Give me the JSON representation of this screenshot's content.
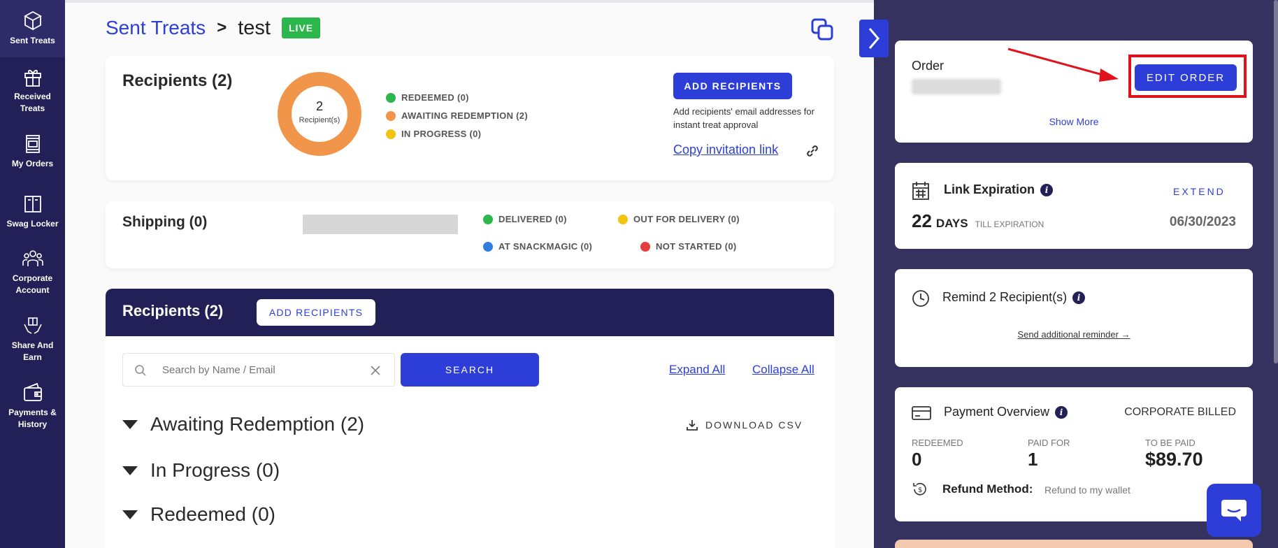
{
  "sidebar": {
    "items": [
      {
        "label": "Sent Treats"
      },
      {
        "label": "Received Treats"
      },
      {
        "label": "My Orders"
      },
      {
        "label": "Swag Locker"
      },
      {
        "label": "Corporate Account"
      },
      {
        "label": "Share And Earn"
      },
      {
        "label": "Payments & History"
      }
    ]
  },
  "breadcrumb": {
    "parent": "Sent Treats",
    "separator": ">",
    "current": "test",
    "badge": "LIVE"
  },
  "recipients_summary": {
    "title": "Recipients (2)",
    "donut_count": "2",
    "donut_label": "Recipient(s)",
    "legend": [
      {
        "label": "REDEEMED (0)",
        "color": "#2bb74b"
      },
      {
        "label": "AWAITING REDEMPTION (2)",
        "color": "#f0954a"
      },
      {
        "label": "IN PROGRESS (0)",
        "color": "#f2c40f"
      }
    ],
    "add_button": "ADD RECIPIENTS",
    "help_text": "Add recipients' email addresses for instant treat approval",
    "copy_link": "Copy invitation link"
  },
  "shipping": {
    "title": "Shipping (0)",
    "legend": [
      {
        "label": "DELIVERED (0)",
        "color": "#2bb74b"
      },
      {
        "label": "OUT FOR DELIVERY (0)",
        "color": "#f2c40f"
      },
      {
        "label": "AT SNACKMAGIC (0)",
        "color": "#2f7ee0"
      },
      {
        "label": "NOT STARTED (0)",
        "color": "#e53e3e"
      }
    ]
  },
  "recipients_table": {
    "title": "Recipients (2)",
    "add_button": "ADD RECIPIENTS",
    "search_placeholder": "Search by Name / Email",
    "search_button": "SEARCH",
    "expand_all": "Expand All",
    "collapse_all": "Collapse All",
    "download_csv": "DOWNLOAD CSV",
    "groups": [
      {
        "label": "Awaiting Redemption (2)"
      },
      {
        "label": "In Progress (0)"
      },
      {
        "label": "Redeemed (0)"
      }
    ]
  },
  "order_card": {
    "label": "Order",
    "edit_button": "EDIT ORDER",
    "show_more": "Show More"
  },
  "expiration_card": {
    "title": "Link Expiration",
    "extend": "EXTEND",
    "days_number": "22",
    "days_unit": "DAYS",
    "days_suffix": "TILL EXPIRATION",
    "date": "06/30/2023"
  },
  "remind_card": {
    "title": "Remind 2 Recipient(s)",
    "link": "Send additional reminder →"
  },
  "payment_card": {
    "title": "Payment Overview",
    "billing": "CORPORATE BILLED",
    "redeemed_label": "REDEEMED",
    "redeemed_value": "0",
    "paid_label": "PAID FOR",
    "paid_value": "1",
    "tobepaid_label": "TO BE PAID",
    "tobepaid_value": "$89.70",
    "refund_label": "Refund Method:",
    "refund_value": "Refund to my wallet"
  },
  "colors": {
    "brand": "#2d3ed8",
    "navy": "#222056",
    "panel": "#35325f",
    "donut": "#f0954a",
    "highlight": "#e0121c",
    "live": "#2bb74b"
  }
}
